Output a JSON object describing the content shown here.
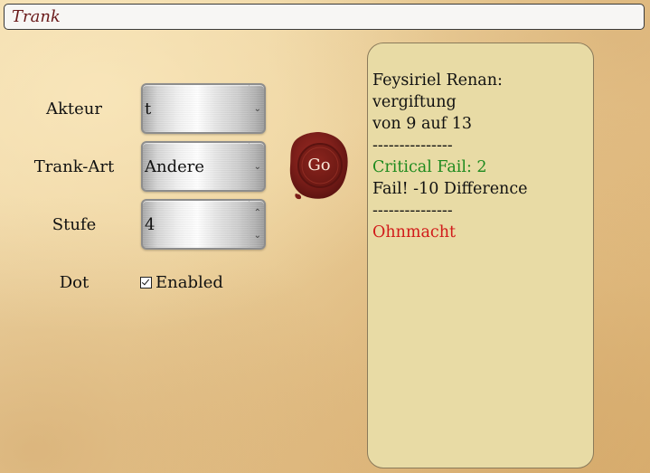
{
  "header": {
    "title": "Trank"
  },
  "form": {
    "akteur": {
      "label": "Akteur",
      "value": "t"
    },
    "trank_art": {
      "label": "Trank-Art",
      "value": "Andere"
    },
    "stufe": {
      "label": "Stufe",
      "value": "4"
    },
    "dot": {
      "label": "Dot",
      "checkbox_label": "Enabled",
      "checked": true
    }
  },
  "go_button": {
    "label": "Go",
    "color": "#7e1f1a"
  },
  "output": {
    "lines": [
      {
        "text": "Feysiriel Renan: vergiftung",
        "color": "#111111"
      },
      {
        "text": "von 9 auf 13",
        "color": "#111111"
      },
      {
        "text": "---------------",
        "color": "#111111"
      },
      {
        "text": "Critical Fail: 2",
        "color": "#1e8a1e"
      },
      {
        "text": "Fail! -10 Difference",
        "color": "#111111"
      },
      {
        "text": "---------------",
        "color": "#111111"
      },
      {
        "text": "Ohnmacht",
        "color": "#d11a1a"
      }
    ]
  }
}
